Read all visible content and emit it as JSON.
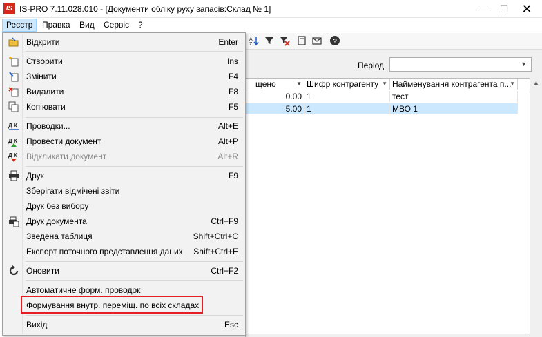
{
  "window": {
    "logo_text": "IS",
    "title": "IS-PRO 7.11.028.010 - [Документи обліку руху запасів:Склад № 1]",
    "min_glyph": "—",
    "max_glyph": "☐",
    "close_glyph": "✕"
  },
  "menubar": {
    "items": [
      "Реєстр",
      "Правка",
      "Вид",
      "Сервіс",
      "?"
    ]
  },
  "toolbar": {
    "icons": [
      "sort-za-icon",
      "filter-icon",
      "clear-filter-icon",
      "document-icon",
      "mail-icon",
      "help-icon"
    ]
  },
  "period": {
    "label": "Період",
    "value": ""
  },
  "grid": {
    "headers": [
      "щено",
      "Шифр контрагенту",
      "Найменування контрагента п..."
    ],
    "rows": [
      {
        "amount": "0.00",
        "code": "1",
        "name": "тест",
        "selected": false
      },
      {
        "amount": "5.00",
        "code": "1",
        "name": "МВО 1",
        "selected": true
      }
    ]
  },
  "menu": {
    "items": [
      {
        "label": "Відкрити",
        "shortcut": "Enter",
        "icon": "open-icon"
      },
      {
        "label": "Створити",
        "shortcut": "Ins",
        "icon": "create-icon"
      },
      {
        "label": "Змінити",
        "shortcut": "F4",
        "icon": "edit-icon"
      },
      {
        "label": "Видалити",
        "shortcut": "F8",
        "icon": "delete-icon"
      },
      {
        "label": "Копіювати",
        "shortcut": "F5",
        "icon": "copy-icon"
      },
      {
        "label": "Проводки...",
        "shortcut": "Alt+E",
        "icon": "entries-icon"
      },
      {
        "label": "Провести документ",
        "shortcut": "Alt+P",
        "icon": "post-document-icon"
      },
      {
        "label": "Відкликати документ",
        "shortcut": "Alt+R",
        "icon": "recall-document-icon",
        "disabled": true
      },
      {
        "label": "Друк",
        "shortcut": "F9",
        "icon": "print-icon"
      },
      {
        "label": "Зберігати відмічені звіти",
        "shortcut": "",
        "icon": ""
      },
      {
        "label": "Друк без вибору",
        "shortcut": "",
        "icon": ""
      },
      {
        "label": "Друк документа",
        "shortcut": "Ctrl+F9",
        "icon": "print-document-icon"
      },
      {
        "label": "Зведена таблиця",
        "shortcut": "Shift+Ctrl+C",
        "icon": ""
      },
      {
        "label": "Експорт поточного представлення даних",
        "shortcut": "Shift+Ctrl+E",
        "icon": ""
      },
      {
        "label": "Оновити",
        "shortcut": "Ctrl+F2",
        "icon": "refresh-icon"
      },
      {
        "label": "Автоматичне форм. проводок",
        "shortcut": "",
        "icon": ""
      },
      {
        "label": "Формування внутр. переміщ. по всіх складах",
        "shortcut": "",
        "icon": "",
        "highlighted": true
      },
      {
        "label": "Вихід",
        "shortcut": "Esc",
        "icon": ""
      }
    ]
  },
  "colors": {
    "highlight_border": "#e31e24",
    "selection": "#cce8ff",
    "logo": "#d9261c"
  }
}
